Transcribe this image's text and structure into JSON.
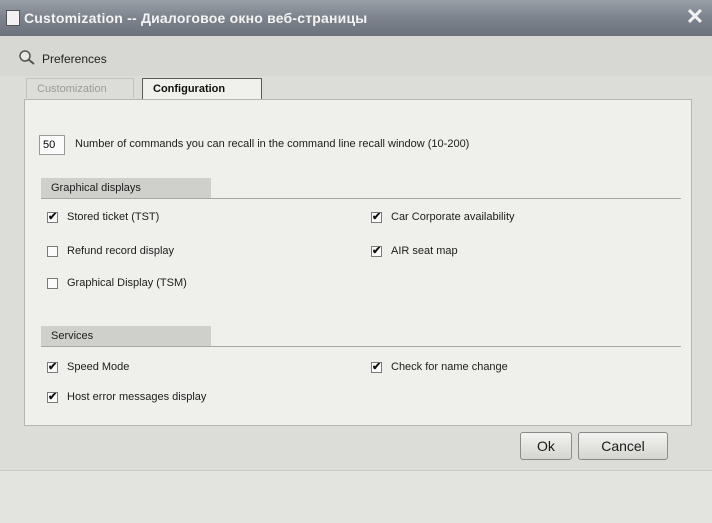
{
  "window": {
    "title": "Customization -- Диалоговое окно веб-страницы",
    "close_glyph": "✕"
  },
  "preferences": {
    "title": "Preferences"
  },
  "tabs": [
    {
      "label": "Customization",
      "active": false
    },
    {
      "label": "Configuration",
      "active": true
    }
  ],
  "recall": {
    "value": "50",
    "label": "Number of commands you can recall in the command line recall window (10-200)"
  },
  "graphical": {
    "header": "Graphical displays",
    "items": [
      {
        "label": "Stored ticket (TST)",
        "checked": true
      },
      {
        "label": "Refund record display",
        "checked": false
      },
      {
        "label": "Graphical Display (TSM)",
        "checked": false
      },
      {
        "label": "Car Corporate availability",
        "checked": true
      },
      {
        "label": "AIR seat map",
        "checked": true
      }
    ]
  },
  "services": {
    "header": "Services",
    "items": [
      {
        "label": "Speed Mode",
        "checked": true
      },
      {
        "label": "Host error messages display",
        "checked": true
      },
      {
        "label": "Check for name change",
        "checked": true
      }
    ]
  },
  "buttons": {
    "ok": "Ok",
    "cancel": "Cancel"
  },
  "check_glyph": "✔"
}
